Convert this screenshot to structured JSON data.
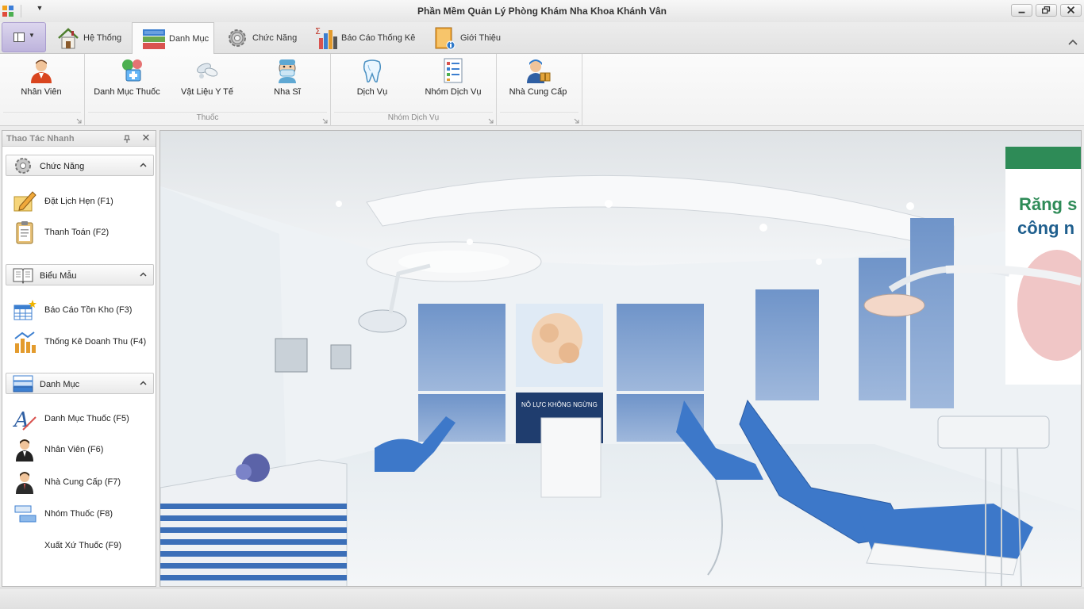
{
  "window": {
    "title": "Phần Mềm Quản Lý Phòng Khám Nha Khoa Khánh Vân",
    "qat_dropdown": "▼"
  },
  "tabs": [
    {
      "label": "Hệ Thống",
      "icon": "house-icon"
    },
    {
      "label": "Danh Mục",
      "icon": "list-icon",
      "active": true
    },
    {
      "label": "Chức Năng",
      "icon": "gear-icon"
    },
    {
      "label": "Báo Cáo Thống Kê",
      "icon": "bar-chart-sigma-icon"
    },
    {
      "label": "Giới Thiệu",
      "icon": "book-info-icon"
    }
  ],
  "ribbon": {
    "groups": [
      {
        "caption": "",
        "buttons": [
          {
            "label": "Nhân Viên",
            "icon": "employee-icon"
          }
        ]
      },
      {
        "caption": "Thuốc",
        "buttons": [
          {
            "label": "Danh Mục Thuốc",
            "icon": "medicine-icon"
          },
          {
            "label": "Vật Liệu Y Tế",
            "icon": "pills-icon"
          },
          {
            "label": "Nha Sĩ",
            "icon": "dentist-icon"
          }
        ]
      },
      {
        "caption": "Nhóm Dịch Vụ",
        "buttons": [
          {
            "label": "Dịch Vụ",
            "icon": "tooth-icon"
          },
          {
            "label": "Nhóm Dịch Vụ",
            "icon": "checklist-icon"
          }
        ]
      },
      {
        "caption": "",
        "buttons": [
          {
            "label": "Nhà Cung Cấp",
            "icon": "supplier-icon"
          }
        ]
      }
    ]
  },
  "quick_panel": {
    "title": "Thao Tác Nhanh",
    "close_glyph": "✕",
    "sections": [
      {
        "label": "Chức Năng",
        "items": [
          {
            "label": "Đặt Lịch Hẹn  (F1)"
          },
          {
            "label": "Thanh Toán (F2)"
          }
        ]
      },
      {
        "label": "Biểu Mẫu",
        "items": [
          {
            "label": "Báo Cáo Tồn Kho (F3)"
          },
          {
            "label": "Thống Kê Doanh Thu (F4)"
          }
        ]
      },
      {
        "label": "Danh Mục",
        "items": [
          {
            "label": "Danh Mục Thuốc (F5)"
          },
          {
            "label": "Nhân Viên (F6)"
          },
          {
            "label": "Nhà Cung Cấp (F7)"
          },
          {
            "label": "Nhóm Thuốc (F8)"
          },
          {
            "label": "Xuất Xứ Thuốc (F9)"
          }
        ]
      }
    ]
  },
  "clinic_photo": {
    "poster_text": "NỖ LỰC KHÔNG NGỪNG",
    "sign_lines": [
      "Răng s",
      "công n"
    ]
  }
}
